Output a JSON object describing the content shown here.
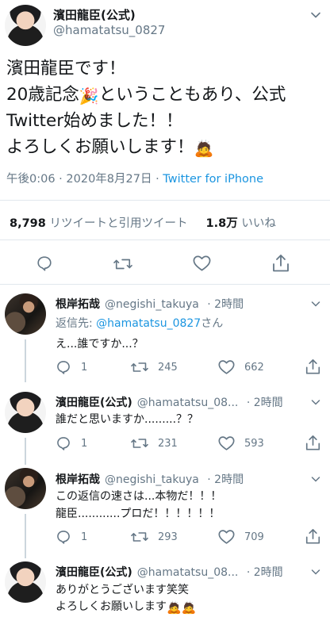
{
  "main_tweet": {
    "author": "濱田龍臣(公式)",
    "handle": "@hamatatsu_0827",
    "line1": "濱田龍臣です！",
    "line2a": "20歳記念",
    "line2b": "ということもあり、公式",
    "line3": "Twitter始めました！！",
    "line4": "よろしくお願いします！",
    "timestamp": "午後0:06 · 2020年8月27日 · ",
    "client": "Twitter for iPhone",
    "retweets_count": "8,798",
    "retweets_label": "リツイートと引用ツイート",
    "likes_count": "1.8万",
    "likes_label": "いいね"
  },
  "replies": [
    {
      "author": "根岸拓哉",
      "handle": "@negishi_takuya",
      "time": "· 2時間",
      "reply_to_prefix": "返信先: ",
      "reply_to_handle": "@hamatatsu_0827",
      "reply_to_suffix": "さん",
      "text1": "え...誰ですか...？",
      "reply_count": "1",
      "retweet_count": "245",
      "like_count": "662"
    },
    {
      "author": "濱田龍臣(公式)",
      "handle": "@hamatatsu_08...",
      "time": "· 2時間",
      "text1": "誰だと思いますか.........？？",
      "reply_count": "1",
      "retweet_count": "231",
      "like_count": "593"
    },
    {
      "author": "根岸拓哉",
      "handle": "@negishi_takuya",
      "time": "· 2時間",
      "text1": "この返信の速さは...本物だ！！！",
      "text2": "龍臣............プロだ！！！！！！",
      "reply_count": "1",
      "retweet_count": "293",
      "like_count": "709"
    },
    {
      "author": "濱田龍臣(公式)",
      "handle": "@hamatatsu_08...",
      "time": "· 2時間",
      "text1": "ありがとうございます笑笑",
      "text2": "よろしくお願いします"
    }
  ],
  "icons": [
    "chevron-down-icon",
    "reply-icon",
    "retweet-icon",
    "like-icon",
    "share-icon",
    "party-popper-emoji",
    "bowing-person-emoji"
  ],
  "colors": {
    "link": "#1b95e0",
    "muted": "#657786",
    "text": "#14171a",
    "divider": "#e1e8ed"
  }
}
